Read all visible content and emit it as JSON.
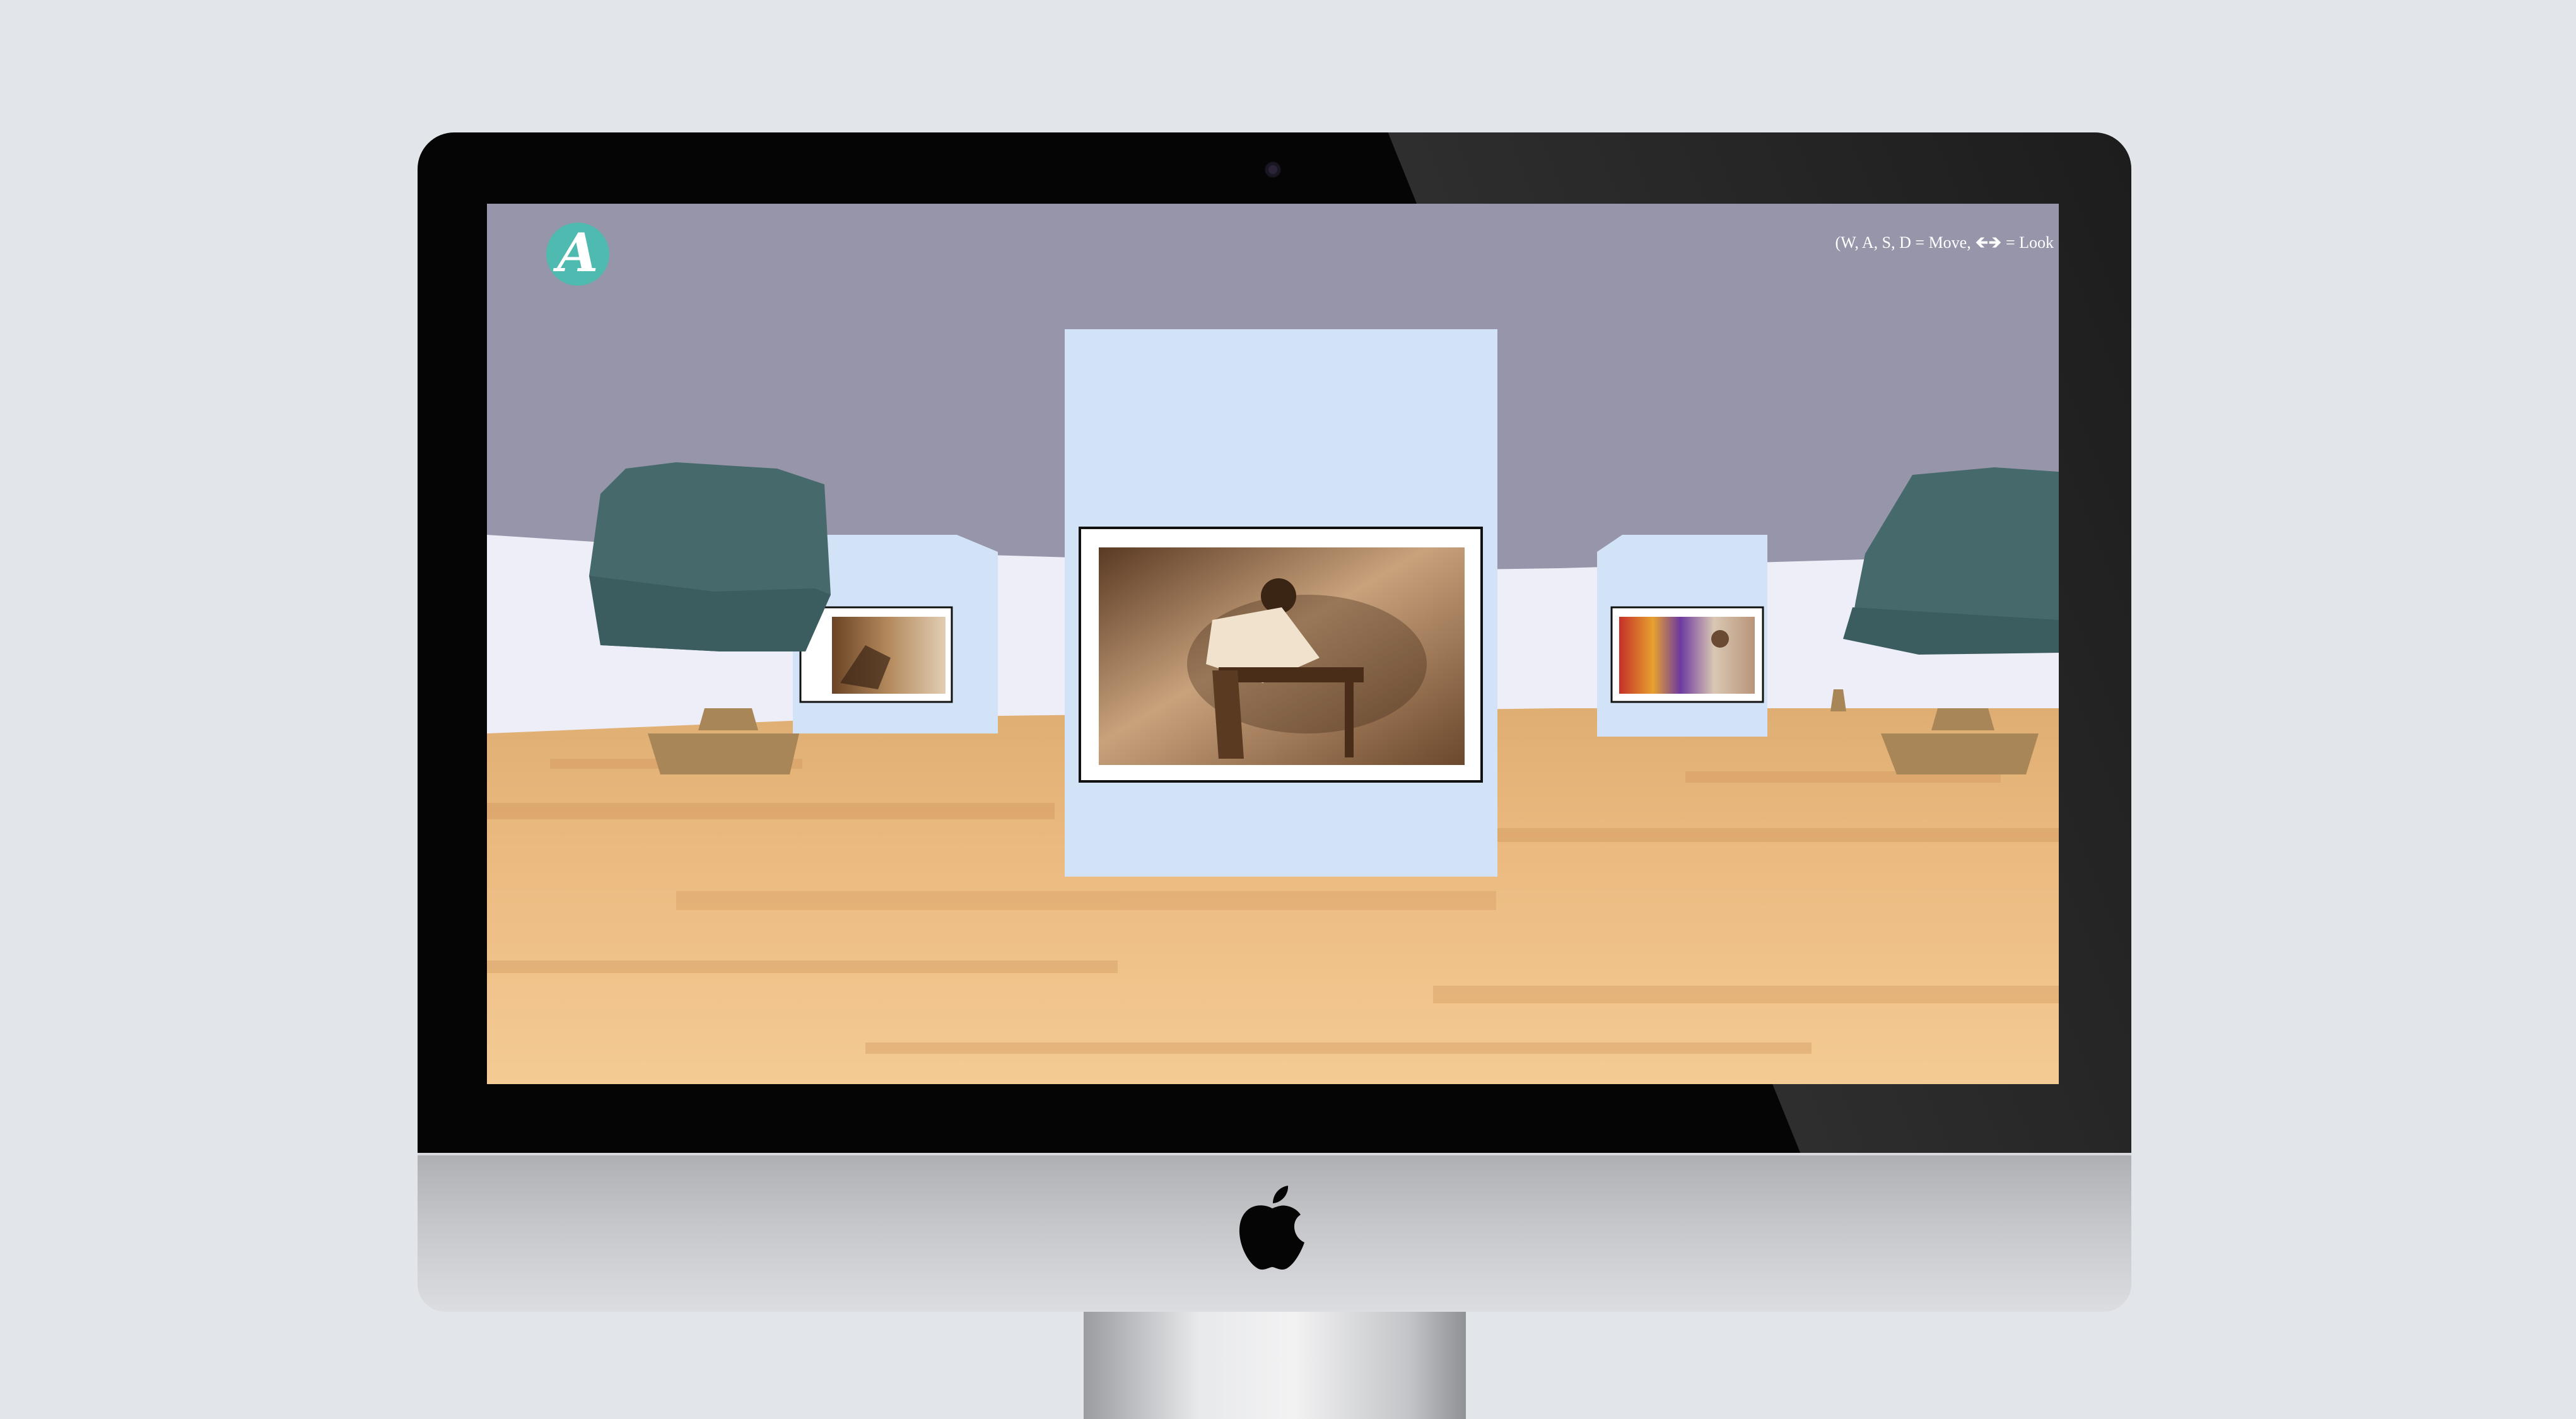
{
  "gallery": {
    "logo_letter": "A",
    "controls_hint": "(W, A, S, D = Move, 🡸🡺 = Look",
    "colors": {
      "sky": "#9695aa",
      "logo_teal": "#4fbab0",
      "pedestal": "#d2e3f7",
      "wall": "#eeeef8",
      "tree_foliage": "#46696b",
      "pot": "#a88658",
      "floor": "#e8b880"
    },
    "artworks": [
      {
        "name": "sepia-photo-carpenter",
        "position": "center"
      },
      {
        "name": "sepia-photo-workers",
        "position": "left"
      },
      {
        "name": "colorful-painting-with-man",
        "position": "right"
      }
    ]
  },
  "device": {
    "icons": [
      "apple-logo-icon",
      "camera-icon"
    ]
  }
}
